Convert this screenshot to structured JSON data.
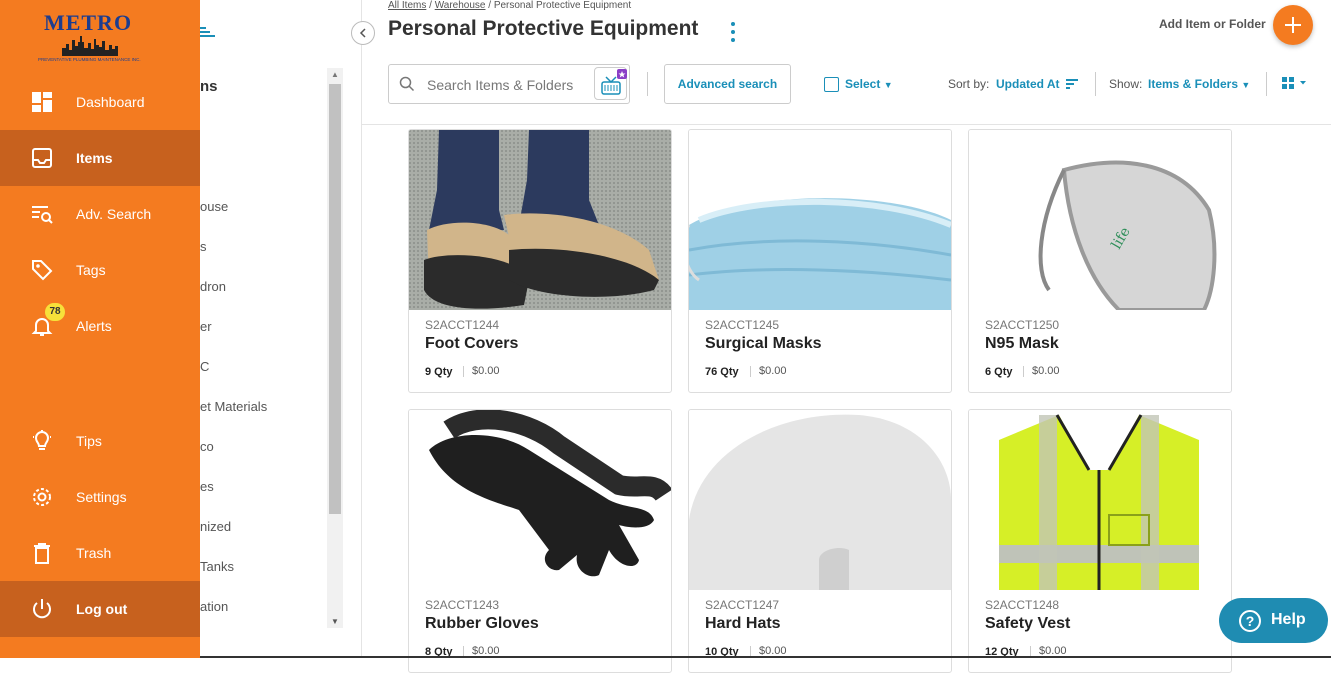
{
  "brand": {
    "name": "METRO",
    "tagline": "PREVENTATIVE PLUMBING MAINTENANCE INC."
  },
  "colors": {
    "accent": "#f47b20",
    "accent_active": "#c7611e",
    "link": "#1a8fb8",
    "help": "#1f8cb2"
  },
  "nav": {
    "items": [
      {
        "label": "Dashboard",
        "icon": "dashboard-icon"
      },
      {
        "label": "Items",
        "icon": "items-icon",
        "active": true
      },
      {
        "label": "Adv. Search",
        "icon": "advanced-search-icon"
      },
      {
        "label": "Tags",
        "icon": "tag-icon"
      },
      {
        "label": "Alerts",
        "icon": "bell-icon",
        "badge": "78"
      },
      {
        "label": "Tips",
        "icon": "lightbulb-icon"
      },
      {
        "label": "Settings",
        "icon": "gear-icon"
      },
      {
        "label": "Trash",
        "icon": "trash-icon"
      },
      {
        "label": "Log out",
        "icon": "power-icon"
      }
    ]
  },
  "tree": {
    "header": "ns",
    "folders": [
      "ouse",
      "s",
      "dron",
      "er",
      "C",
      "et Materials",
      "co",
      "es",
      "nized",
      "Tanks",
      "ation"
    ]
  },
  "breadcrumb": {
    "root": "All Items",
    "parent": "Warehouse",
    "current": "Personal Protective Equipment"
  },
  "page": {
    "title": "Personal Protective Equipment",
    "add_label": "Add Item or Folder"
  },
  "toolbar": {
    "search_placeholder": "Search Items & Folders",
    "advanced_search": "Advanced search",
    "select": "Select",
    "sort_label": "Sort by:",
    "sort_value": "Updated At",
    "show_label": "Show:",
    "show_value": "Items & Folders"
  },
  "items": [
    {
      "sku": "S2ACCT1244",
      "name": "Foot Covers",
      "qty": "9 Qty",
      "price": "$0.00"
    },
    {
      "sku": "S2ACCT1245",
      "name": "Surgical Masks",
      "qty": "76 Qty",
      "price": "$0.00"
    },
    {
      "sku": "S2ACCT1250",
      "name": "N95 Mask",
      "qty": "6 Qty",
      "price": "$0.00"
    },
    {
      "sku": "S2ACCT1243",
      "name": "Rubber Gloves",
      "qty": "8 Qty",
      "price": "$0.00"
    },
    {
      "sku": "S2ACCT1247",
      "name": "Hard Hats",
      "qty": "10 Qty",
      "price": "$0.00"
    },
    {
      "sku": "S2ACCT1248",
      "name": "Safety Vest",
      "qty": "12 Qty",
      "price": "$0.00"
    }
  ],
  "help": {
    "label": "Help"
  }
}
